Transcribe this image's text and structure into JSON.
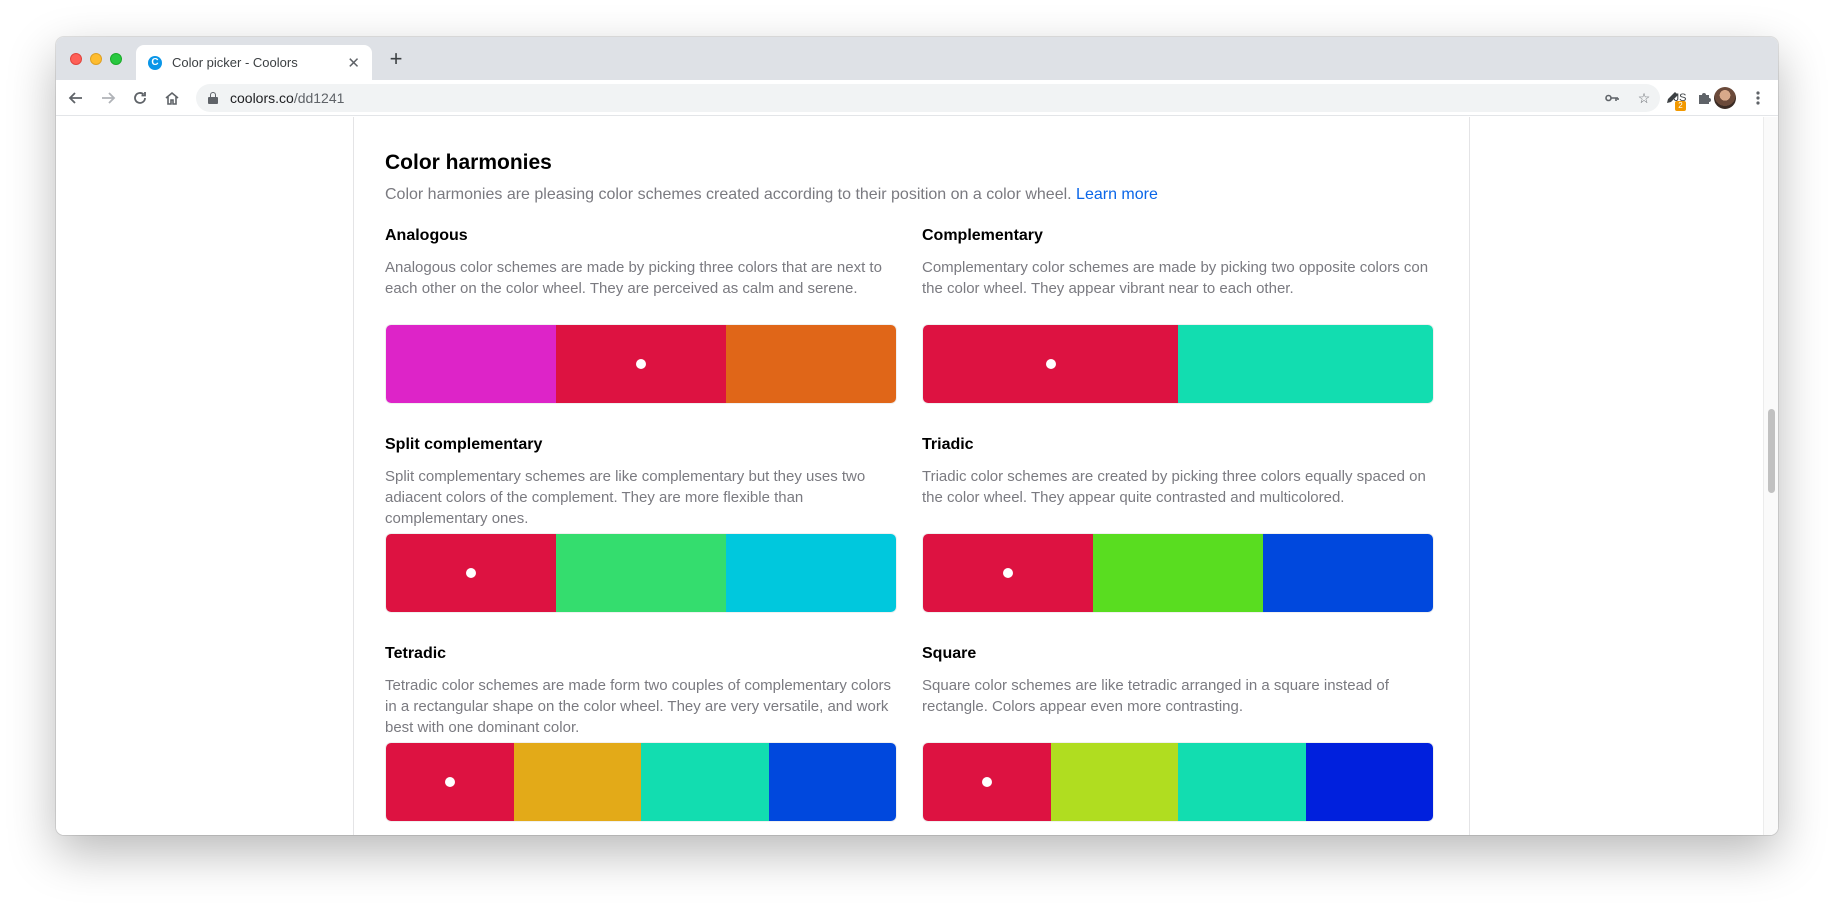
{
  "browser": {
    "tab_title": "Color picker - Coolors",
    "favicon_letter": "C",
    "new_tab": "+",
    "url_host": "coolors.co",
    "url_path": "/dd1241",
    "ext_js_label": "JS",
    "ext_badge": "2"
  },
  "section": {
    "title": "Color harmonies",
    "description": "Color harmonies are pleasing color schemes created according to their position on a color wheel.",
    "learn_more": "Learn more"
  },
  "harmonies": [
    {
      "title": "Analogous",
      "description": "Analogous color schemes are made by picking three colors that are next to each other on the color wheel. They are perceived as calm and serene.",
      "colors": [
        "#dd24c8",
        "#dd1241",
        "#e06618"
      ],
      "selected": 1
    },
    {
      "title": "Complementary",
      "description": "Complementary color schemes are made by picking two opposite colors con the color wheel. They appear vibrant near to each other.",
      "colors": [
        "#dd1241",
        "#12ddb0"
      ],
      "selected": 0
    },
    {
      "title": "Split complementary",
      "description": "Split complementary schemes are like complementary but they uses two adiacent colors of the complement. They are more flexible than complementary ones.",
      "colors": [
        "#dd1241",
        "#34dd6e",
        "#00c8dd"
      ],
      "selected": 0
    },
    {
      "title": "Triadic",
      "description": "Triadic color schemes are created by picking three colors equally spaced on the color wheel. They appear quite contrasted and multicolored.",
      "colors": [
        "#dd1241",
        "#59dd20",
        "#0048dd"
      ],
      "selected": 0
    },
    {
      "title": "Tetradic",
      "description": "Tetradic color schemes are made form two couples of complementary colors in a rectangular shape on the color wheel. They are very versatile, and work best with one dominant color.",
      "colors": [
        "#dd1241",
        "#e3aa18",
        "#12ddb0",
        "#0048dd"
      ],
      "selected": 0
    },
    {
      "title": "Square",
      "description": "Square color schemes are like tetradic arranged in a square instead of rectangle. Colors appear even more contrasting.",
      "colors": [
        "#dd1241",
        "#b0dd20",
        "#12ddb0",
        "#0020dd"
      ],
      "selected": 0
    }
  ]
}
